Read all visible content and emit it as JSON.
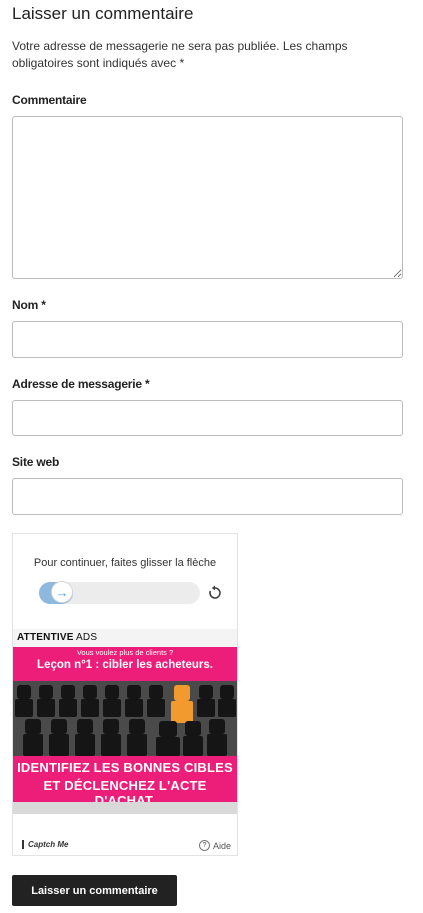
{
  "form": {
    "title": "Laisser un commentaire",
    "notice": "Votre adresse de messagerie ne sera pas publiée. Les champs obligatoires sont indiqués avec *",
    "comment_label": "Commentaire",
    "comment_value": "",
    "name_label": "Nom *",
    "name_value": "",
    "email_label": "Adresse de messagerie *",
    "email_value": "",
    "website_label": "Site web",
    "website_value": "",
    "submit_label": "Laisser un commentaire"
  },
  "captcha": {
    "instruction": "Pour continuer, faites glisser la flèche",
    "slider_progress_percent": 0,
    "refresh_icon": "refresh-icon",
    "ad": {
      "brand_bold": "ATTENTIVE",
      "brand_light": " ADS",
      "question": "Vous voulez plus de clients ?",
      "lesson": "Leçon n°1 : cibler les acheteurs.",
      "cta_line1": "IDENTIFIEZ LES BONNES CIBLES",
      "cta_line2": "ET DÉCLENCHEZ L'ACTE D'ACHAT.",
      "pink_color": "#ec1e79",
      "highlight_color": "#f39a2e"
    },
    "brand": "Captch Me",
    "help_label": "Aide"
  }
}
